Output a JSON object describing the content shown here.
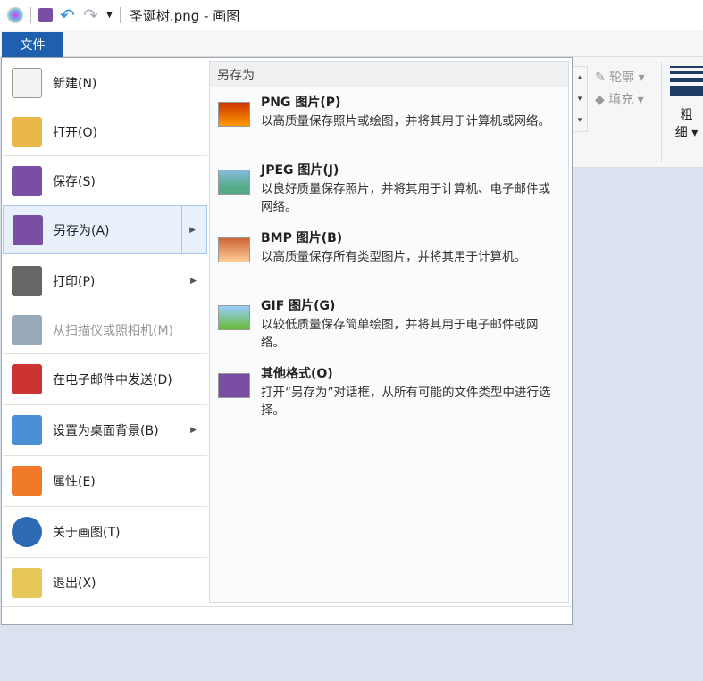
{
  "titlebar": {
    "title": "圣诞树.png - 画图",
    "icons": [
      "paint-app-icon",
      "save-icon",
      "undo-icon",
      "redo-icon",
      "customize-dropdown-icon"
    ]
  },
  "file_tab": "文件",
  "ribbon": {
    "outline": "轮廓",
    "fill": "填充",
    "size_label_1": "粗",
    "size_label_2": "细"
  },
  "menu": {
    "items": [
      {
        "label": "新建(N)",
        "icon": "new-file-icon"
      },
      {
        "label": "打开(O)",
        "icon": "open-folder-icon"
      },
      {
        "label": "保存(S)",
        "icon": "save-icon"
      },
      {
        "label": "另存为(A)",
        "icon": "save-as-icon",
        "submenu": true,
        "selected": true
      },
      {
        "label": "打印(P)",
        "icon": "printer-icon",
        "submenu": true
      },
      {
        "label": "从扫描仪或照相机(M)",
        "icon": "scanner-icon",
        "disabled": true
      },
      {
        "label": "在电子邮件中发送(D)",
        "icon": "email-icon"
      },
      {
        "label": "设置为桌面背景(B)",
        "icon": "desktop-background-icon",
        "submenu": true
      },
      {
        "label": "属性(E)",
        "icon": "properties-check-icon"
      },
      {
        "label": "关于画图(T)",
        "icon": "info-icon"
      },
      {
        "label": "退出(X)",
        "icon": "exit-icon"
      }
    ]
  },
  "submenu": {
    "header": "另存为",
    "items": [
      {
        "title": "PNG 图片(P)",
        "desc": "以高质量保存照片或绘图，并将其用于计算机或网络。",
        "icon": "png-image-icon"
      },
      {
        "title": "JPEG 图片(J)",
        "desc": "以良好质量保存照片，并将其用于计算机、电子邮件或网络。",
        "icon": "jpeg-image-icon"
      },
      {
        "title": "BMP 图片(B)",
        "desc": "以高质量保存所有类型图片，并将其用于计算机。",
        "icon": "bmp-image-icon"
      },
      {
        "title": "GIF 图片(G)",
        "desc": "以较低质量保存简单绘图，并将其用于电子邮件或网络。",
        "icon": "gif-image-icon"
      },
      {
        "title": "其他格式(O)",
        "desc": "打开“另存为”对话框，从所有可能的文件类型中进行选择。",
        "icon": "other-formats-icon"
      }
    ]
  }
}
